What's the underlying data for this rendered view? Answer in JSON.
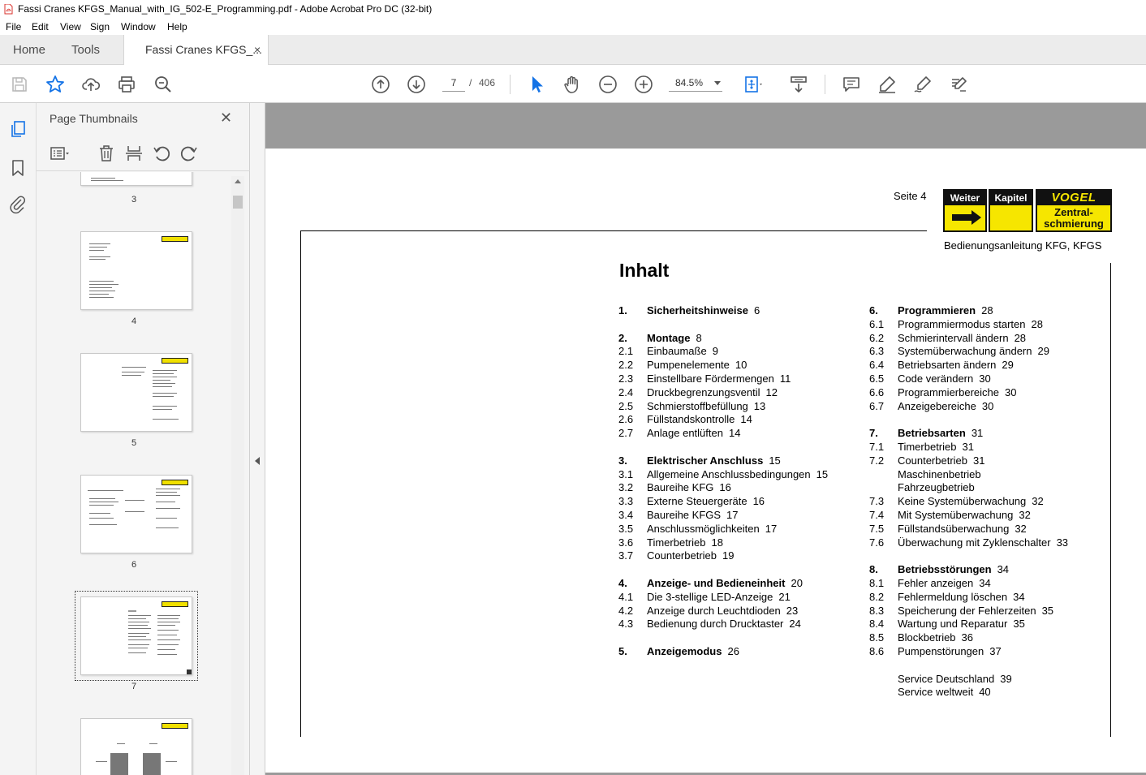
{
  "window": {
    "title": "Fassi Cranes KFGS_Manual_with_IG_502-E_Programming.pdf - Adobe Acrobat Pro DC (32-bit)"
  },
  "menu": [
    "File",
    "Edit",
    "View",
    "Sign",
    "Window",
    "Help"
  ],
  "tabs": {
    "home": "Home",
    "tools": "Tools",
    "document": "Fassi Cranes KFGS_...",
    "close": "×"
  },
  "toolbar": {
    "page_current": "7",
    "page_separator": "/",
    "page_total": "406",
    "zoom": "84.5%"
  },
  "thumbnails": {
    "title": "Page Thumbnails",
    "close": "✕",
    "pages": [
      "3",
      "4",
      "5",
      "6",
      "7"
    ],
    "selected": "7"
  },
  "document": {
    "seite": "Seite 4",
    "logo": {
      "weiter": "Weiter",
      "kapitel": "Kapitel",
      "vogel": "VOGEL",
      "vogel_sub_1": "Zentral-",
      "vogel_sub_2": "schmierung"
    },
    "subtitle": "Bedienungsanleitung KFG, KFGS",
    "heading": "Inhalt",
    "toc_left": [
      {
        "num": "1.",
        "text": "Sicherheitshinweise",
        "page": "6",
        "bold": true
      },
      {
        "num": "2.",
        "text": "Montage",
        "page": "8",
        "bold": true
      },
      {
        "num": "2.1",
        "text": "Einbaumaße",
        "page": "9"
      },
      {
        "num": "2.2",
        "text": "Pumpenelemente",
        "page": "10"
      },
      {
        "num": "2.3",
        "text": "Einstellbare Fördermengen",
        "page": "11"
      },
      {
        "num": "2.4",
        "text": "Druckbegrenzungsventil",
        "page": "12"
      },
      {
        "num": "2.5",
        "text": "Schmierstoffbefüllung",
        "page": "13"
      },
      {
        "num": "2.6",
        "text": "Füllstandskontrolle",
        "page": "14"
      },
      {
        "num": "2.7",
        "text": "Anlage entlüften",
        "page": "14"
      },
      {
        "num": "3.",
        "text": "Elektrischer Anschluss",
        "page": "15",
        "bold": true
      },
      {
        "num": "3.1",
        "text": "Allgemeine Anschlussbedingungen",
        "page": "15"
      },
      {
        "num": "3.2",
        "text": "Baureihe KFG",
        "page": "16"
      },
      {
        "num": "3.3",
        "text": "Externe Steuergeräte",
        "page": "16"
      },
      {
        "num": "3.4",
        "text": "Baureihe KFGS",
        "page": "17"
      },
      {
        "num": "3.5",
        "text": "Anschlussmöglichkeiten",
        "page": "17"
      },
      {
        "num": "3.6",
        "text": "Timerbetrieb",
        "page": "18"
      },
      {
        "num": "3.7",
        "text": "Counterbetrieb",
        "page": "19"
      },
      {
        "num": "4.",
        "text": "Anzeige- und Bedieneinheit",
        "page": "20",
        "bold": true
      },
      {
        "num": "4.1",
        "text": "Die 3-stellige LED-Anzeige",
        "page": "21"
      },
      {
        "num": "4.2",
        "text": "Anzeige durch Leuchtdioden",
        "page": "23"
      },
      {
        "num": "4.3",
        "text": "Bedienung durch Drucktaster",
        "page": "24"
      },
      {
        "num": "5.",
        "text": "Anzeigemodus",
        "page": "26",
        "bold": true
      }
    ],
    "toc_right": [
      {
        "num": "6.",
        "text": "Programmieren",
        "page": "28",
        "bold": true
      },
      {
        "num": "6.1",
        "text": "Programmiermodus starten",
        "page": "28"
      },
      {
        "num": "6.2",
        "text": "Schmierintervall ändern",
        "page": "28"
      },
      {
        "num": "6.3",
        "text": "Systemüberwachung ändern",
        "page": "29"
      },
      {
        "num": "6.4",
        "text": "Betriebsarten ändern",
        "page": "29"
      },
      {
        "num": "6.5",
        "text": "Code verändern",
        "page": "30"
      },
      {
        "num": "6.6",
        "text": "Programmierbereiche",
        "page": "30"
      },
      {
        "num": "6.7",
        "text": "Anzeigebereiche",
        "page": "30"
      },
      {
        "num": "7.",
        "text": "Betriebsarten",
        "page": "31",
        "bold": true
      },
      {
        "num": "7.1",
        "text": "Timerbetrieb",
        "page": "31"
      },
      {
        "num": "7.2",
        "text": "Counterbetrieb",
        "page": "31"
      },
      {
        "num": "",
        "text": "Maschinenbetrieb",
        "page": ""
      },
      {
        "num": "",
        "text": "Fahrzeugbetrieb",
        "page": ""
      },
      {
        "num": "7.3",
        "text": "Keine Systemüberwachung",
        "page": "32"
      },
      {
        "num": "7.4",
        "text": "Mit Systemüberwachung",
        "page": "32"
      },
      {
        "num": "7.5",
        "text": "Füllstandsüberwachung",
        "page": "32"
      },
      {
        "num": "7.6",
        "text": "Überwachung mit Zyklenschalter",
        "page": "33"
      },
      {
        "num": "8.",
        "text": "Betriebsstörungen",
        "page": "34",
        "bold": true
      },
      {
        "num": "8.1",
        "text": "Fehler anzeigen",
        "page": "34"
      },
      {
        "num": "8.2",
        "text": "Fehlermeldung löschen",
        "page": "34"
      },
      {
        "num": "8.3",
        "text": "Speicherung der Fehlerzeiten",
        "page": "35"
      },
      {
        "num": "8.4",
        "text": "Wartung und Reparatur",
        "page": "35"
      },
      {
        "num": "8.5",
        "text": "Blockbetrieb",
        "page": "36"
      },
      {
        "num": "8.6",
        "text": "Pumpenstörungen",
        "page": "37"
      },
      {
        "num": "",
        "text": "Service Deutschland",
        "page": "39"
      },
      {
        "num": "",
        "text": "Service weltweit",
        "page": "40"
      }
    ]
  },
  "colors": {
    "accent_blue": "#1473e6",
    "logo_yellow": "#f6e600",
    "pdf_red": "#d9302b"
  }
}
